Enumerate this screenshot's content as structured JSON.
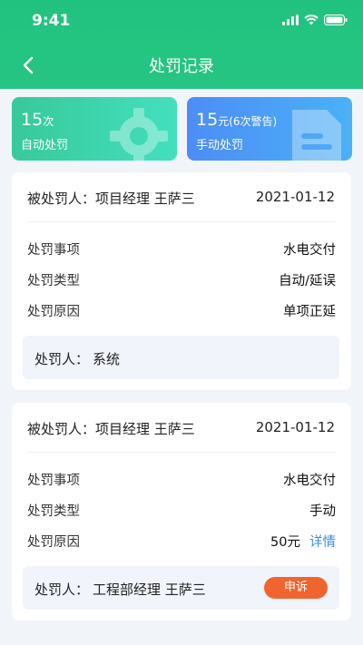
{
  "status_bar": {
    "time": "9:41"
  },
  "nav": {
    "title": "处罚记录"
  },
  "stats": {
    "auto": {
      "count": "15",
      "unit": "次",
      "label": "自动处罚"
    },
    "manual": {
      "amount": "15",
      "unit": "元(6次警告)",
      "label": "手动处罚"
    }
  },
  "records": [
    {
      "punished": "被处罚人：项目经理 王萨三",
      "date": "2021-01-12",
      "rows": [
        {
          "key": "处罚事项",
          "value": "水电交付"
        },
        {
          "key": "处罚类型",
          "value": "自动/延误"
        },
        {
          "key": "处罚原因",
          "value": "单项正延"
        }
      ],
      "punisher_label": "处罚人：",
      "punisher_value": "系统"
    },
    {
      "punished": "被处罚人：项目经理 王萨三",
      "date": "2021-01-12",
      "rows": [
        {
          "key": "处罚事项",
          "value": "水电交付"
        },
        {
          "key": "处罚类型",
          "value": "手动"
        },
        {
          "key": "处罚原因",
          "value": "50元",
          "link": "详情"
        }
      ],
      "punisher_label": "处罚人：",
      "punisher_value": "工程部经理 王萨三",
      "appeal": "申诉"
    }
  ]
}
